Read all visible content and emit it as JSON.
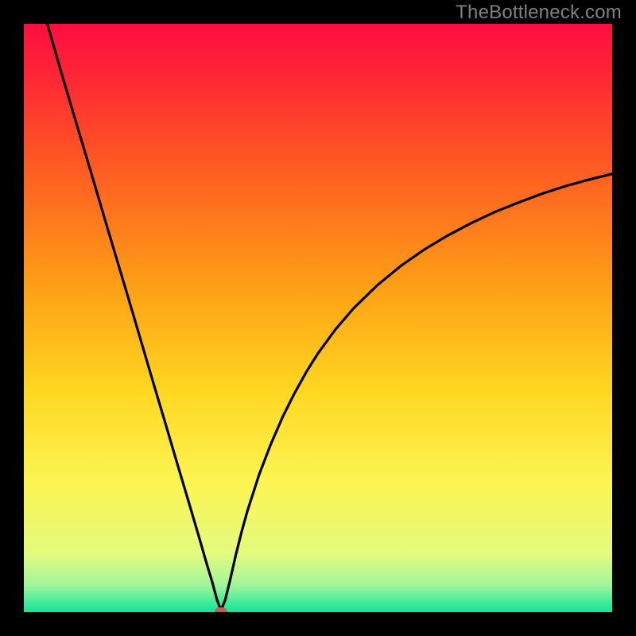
{
  "watermark": "TheBottleneck.com",
  "colors": {
    "marker_fill": "#c65a5a",
    "marker_stroke": "#000000",
    "curve": "#000000",
    "gradient_stops": [
      {
        "offset": 0.0,
        "color": "#ff0d40"
      },
      {
        "offset": 0.1,
        "color": "#ff2a34"
      },
      {
        "offset": 0.25,
        "color": "#ff5d22"
      },
      {
        "offset": 0.45,
        "color": "#ffa015"
      },
      {
        "offset": 0.62,
        "color": "#ffd620"
      },
      {
        "offset": 0.78,
        "color": "#fcf552"
      },
      {
        "offset": 0.9,
        "color": "#e4fb7e"
      },
      {
        "offset": 0.955,
        "color": "#9ff59a"
      },
      {
        "offset": 0.985,
        "color": "#3bea9a"
      },
      {
        "offset": 1.0,
        "color": "#15e49a"
      }
    ]
  },
  "chart_data": {
    "type": "line",
    "title": "",
    "xlabel": "",
    "ylabel": "",
    "xlim": [
      0,
      100
    ],
    "ylim": [
      0,
      100
    ],
    "grid": false,
    "marker": {
      "x": 33.5,
      "y": 0
    },
    "series": [
      {
        "name": "bottleneck-curve",
        "x": [
          4,
          6,
          8,
          10,
          12,
          14,
          16,
          18,
          20,
          22,
          24,
          26,
          28,
          30,
          31,
          32,
          32.8,
          33.5,
          34.2,
          35,
          36,
          37,
          38,
          40,
          42,
          44,
          46,
          48,
          50,
          53,
          56,
          60,
          64,
          68,
          72,
          76,
          80,
          84,
          88,
          92,
          96,
          100
        ],
        "y": [
          100,
          93,
          86.2,
          79.5,
          72.8,
          66,
          59.3,
          52.6,
          45.8,
          39,
          32.3,
          25.5,
          18.8,
          12,
          8.5,
          5.2,
          2.2,
          0.3,
          2.0,
          5.2,
          9.6,
          13.6,
          17.2,
          23.4,
          28.6,
          33.2,
          37.2,
          40.8,
          44,
          48.1,
          51.6,
          55.5,
          58.8,
          61.6,
          64.0,
          66.1,
          68.0,
          69.6,
          71.1,
          72.4,
          73.5,
          74.5
        ]
      }
    ]
  }
}
